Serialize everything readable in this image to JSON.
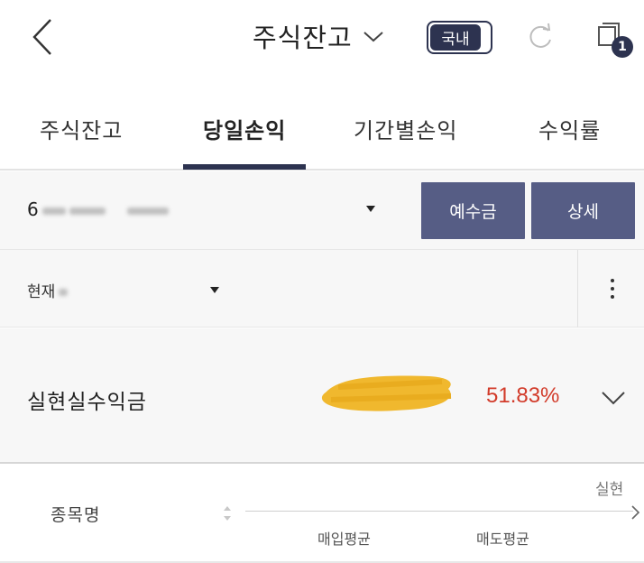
{
  "header": {
    "title": "주식잔고",
    "toggle_label": "국내",
    "window_badge": "1",
    "icons": [
      "back-icon",
      "chevron-down-icon",
      "refresh-icon",
      "window-icon"
    ]
  },
  "tabs": [
    {
      "label": "주식잔고",
      "active": false
    },
    {
      "label": "당일손익",
      "active": true
    },
    {
      "label": "기간별손익",
      "active": false
    },
    {
      "label": "수익률",
      "active": false
    }
  ],
  "account": {
    "number_prefix": "6",
    "deposit_label": "예수금",
    "detail_label": "상세"
  },
  "filter": {
    "selected": "현재"
  },
  "summary": {
    "label": "실현실수익금",
    "rate": "51.83%"
  },
  "columns": {
    "name": "종목명",
    "buy_avg": "매입평균",
    "sell_avg": "매도평균",
    "realized": "실현"
  },
  "colors": {
    "accent": "#2d3350",
    "button": "#565d85",
    "positive": "#d23b2a",
    "redaction": "#f0b82e"
  }
}
